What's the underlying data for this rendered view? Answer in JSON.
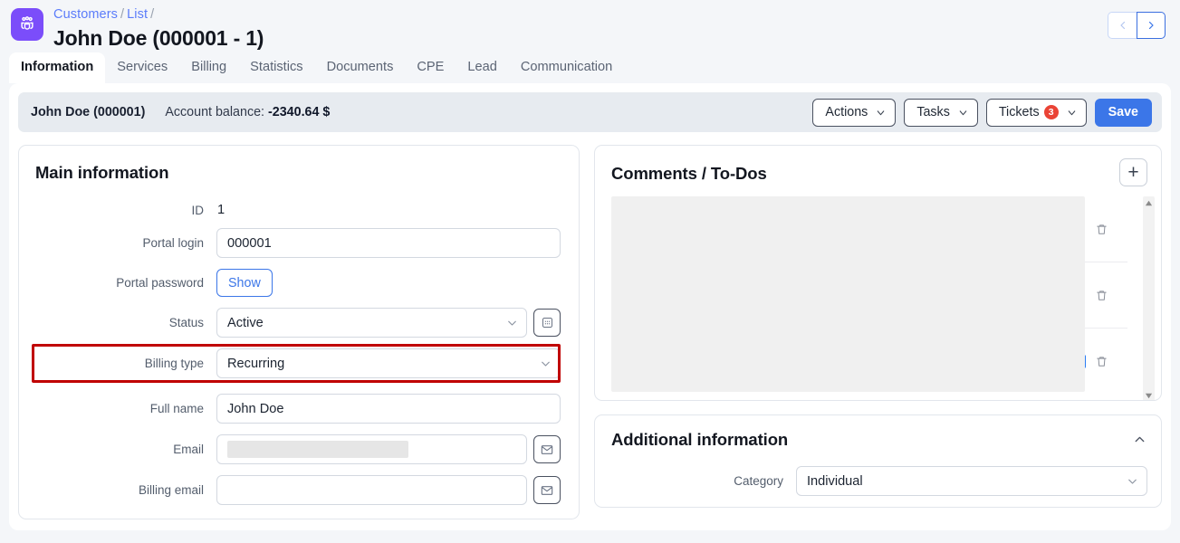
{
  "app": {
    "logo_icon": "customers-group-icon",
    "breadcrumb": [
      {
        "label": "Customers",
        "href_like": true
      },
      {
        "label": "List",
        "href_like": true
      }
    ],
    "breadcrumb_separator": "/",
    "page_title": "John Doe (000001 - 1)",
    "pager": {
      "prev_icon": "chevron-left-icon",
      "next_icon": "chevron-right-icon"
    },
    "accent_blue": "#3b76e8",
    "brand_purple": "#7b4dfa",
    "danger_red": "#ea4335",
    "highlight_red": "#c00000"
  },
  "tabs": [
    {
      "label": "Information",
      "active": true
    },
    {
      "label": "Services",
      "active": false
    },
    {
      "label": "Billing",
      "active": false
    },
    {
      "label": "Statistics",
      "active": false
    },
    {
      "label": "Documents",
      "active": false
    },
    {
      "label": "CPE",
      "active": false
    },
    {
      "label": "Lead",
      "active": false
    },
    {
      "label": "Communication",
      "active": false
    }
  ],
  "toolbar": {
    "customer_name": "John Doe (000001)",
    "balance_label": "Account balance:",
    "balance_value": "-2340.64 $",
    "actions_label": "Actions",
    "tasks_label": "Tasks",
    "tickets_label": "Tickets",
    "tickets_count": "3",
    "save_label": "Save",
    "caret_icon": "chevron-down-icon"
  },
  "main_information": {
    "title": "Main information",
    "fields": {
      "id": {
        "label": "ID",
        "value": "1"
      },
      "portal_login": {
        "label": "Portal login",
        "value": "000001",
        "placeholder": ""
      },
      "portal_password": {
        "label": "Portal password",
        "button_label": "Show"
      },
      "status": {
        "label": "Status",
        "value": "Active",
        "extra_icon": "grid-dots-icon"
      },
      "billing_type": {
        "label": "Billing type",
        "value": "Recurring",
        "highlighted": true
      },
      "full_name": {
        "label": "Full name",
        "value": "John Doe",
        "placeholder": ""
      },
      "email": {
        "label": "Email",
        "value": "",
        "placeholder": "",
        "redacted": true,
        "action_icon": "envelope-icon"
      },
      "billing_email": {
        "label": "Billing email",
        "value": "",
        "placeholder": "",
        "action_icon": "envelope-icon"
      }
    }
  },
  "comments": {
    "title": "Comments / To-Dos",
    "add_label": "+",
    "rows": [
      {
        "edit_icon": "pencil-icon",
        "delete_icon": "trash-icon",
        "checkbox": false
      },
      {
        "edit_icon": "pencil-icon",
        "delete_icon": "trash-icon",
        "checkbox": false
      },
      {
        "edit_icon": "",
        "delete_icon": "trash-icon",
        "checkbox": true
      }
    ],
    "scrollbar": {
      "up_icon": "triangle-up-icon",
      "down_icon": "triangle-down-icon"
    }
  },
  "additional_information": {
    "title": "Additional information",
    "collapse_icon": "chevron-up-icon",
    "category": {
      "label": "Category",
      "value": "Individual"
    }
  }
}
